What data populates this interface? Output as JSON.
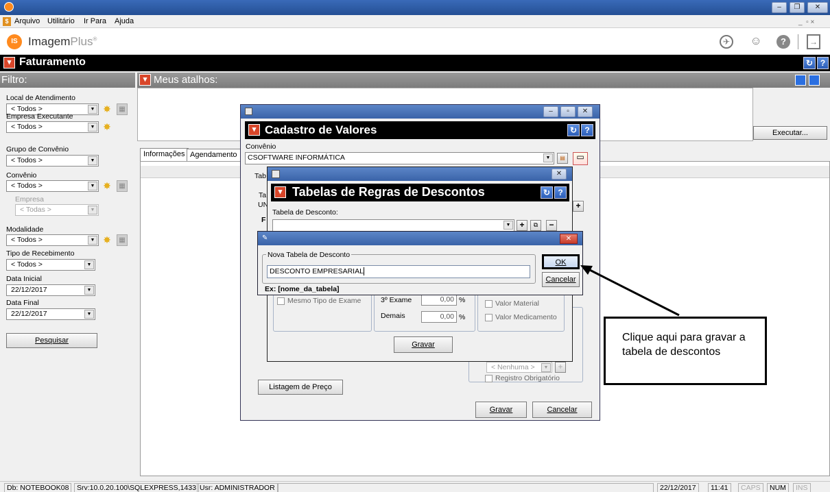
{
  "menu": [
    "Arquivo",
    "Utilitário",
    "Ir Para",
    "Ajuda"
  ],
  "logo": {
    "text": "Imagem",
    "plus": "Plus",
    "reg": "®"
  },
  "module_title": "Faturamento",
  "filter": {
    "header": "Filtro:",
    "local_label": "Local de Atendimento",
    "local_value": "< Todos >",
    "empresa_exec_label": "Empresa Executante",
    "empresa_exec_value": "< Todos >",
    "grupo_label": "Grupo de Convênio",
    "grupo_value": "< Todos >",
    "convenio_label": "Convênio",
    "convenio_value": "< Todos >",
    "empresa_label": "Empresa",
    "empresa_value": "< Todas >",
    "modalidade_label": "Modalidade",
    "modalidade_value": "< Todos >",
    "tipo_receb_label": "Tipo de Recebimento",
    "tipo_receb_value": "< Todos >",
    "data_inicial_label": "Data Inicial",
    "data_inicial_value": "22/12/2017",
    "data_final_label": "Data Final",
    "data_final_value": "22/12/2017",
    "pesquisar": "Pesquisar"
  },
  "shortcuts": {
    "header": "Meus atalhos:",
    "executar": "Executar..."
  },
  "tabs": [
    "Informações",
    "Agendamento"
  ],
  "cadastro": {
    "title": "Cadastro de Valores",
    "convenio_label": "Convênio",
    "convenio_value": "CSOFTWARE INFORMÁTICA",
    "tab_label": "Tab",
    "ta_label": "Ta",
    "un_value": "UN",
    "f_label": "F",
    "nenhuma": "< Nenhuma >",
    "registro_obrigatorio": "Registro Obrigatório",
    "listagem": "Listagem de Preço",
    "gravar": "Gravar",
    "cancelar": "Cancelar"
  },
  "regras": {
    "title": "Tabelas de Regras de Descontos",
    "tabela_label": "Tabela de Desconto:",
    "mesmo_tipo": "Mesmo Tipo de Exame",
    "exame3_label": "3º Exame",
    "exame3_value": "0,00",
    "demais_label": "Demais",
    "demais_value": "0,00",
    "pct": "%",
    "valor_material": "Valor Material",
    "valor_medicamento": "Valor Medicamento",
    "gravar": "Gravar"
  },
  "nova": {
    "group_label": "Nova Tabela de Desconto",
    "input_value": "DESCONTO EMPRESARIAL",
    "ok": "OK",
    "cancelar": "Cancelar",
    "hint": "Ex: [nome_da_tabela]"
  },
  "callout": "Clique aqui para gravar a tabela de descontos",
  "status": {
    "db": "Db: NOTEBOOK08",
    "srv": "Srv:10.0.20.100\\SQLEXPRESS,1433",
    "usr": "Usr: ADMINISTRADOR",
    "date": "22/12/2017",
    "time": "11:41",
    "caps": "CAPS",
    "num": "NUM",
    "ins": "INS"
  },
  "colors": {
    "accent_red": "#d8462a",
    "title_blue": "#3a63a8",
    "logo_orange": "#ff8a1e"
  }
}
